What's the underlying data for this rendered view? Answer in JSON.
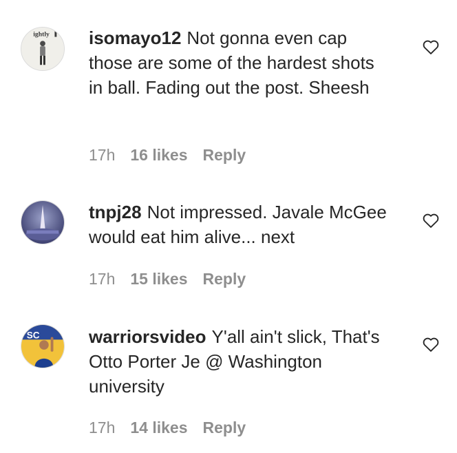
{
  "comments": [
    {
      "username": "isomayo12",
      "text": "Not gonna even cap those are some of the hardest shots in ball. Fading out the post. Sheesh",
      "time": "17h",
      "likes": "16 likes",
      "reply": "Reply",
      "avatar_text": "ightly"
    },
    {
      "username": "tnpj28",
      "text": "Not impressed. Javale McGee would eat him alive... next",
      "time": "17h",
      "likes": "15 likes",
      "reply": "Reply"
    },
    {
      "username": "warriorsvideo",
      "text": "Y'all ain't slick, That's Otto Porter Je @ Washington university",
      "time": "17h",
      "likes": "14 likes",
      "reply": "Reply",
      "avatar_text": "SC"
    }
  ],
  "icons": {
    "like": "heart-outline-icon"
  }
}
